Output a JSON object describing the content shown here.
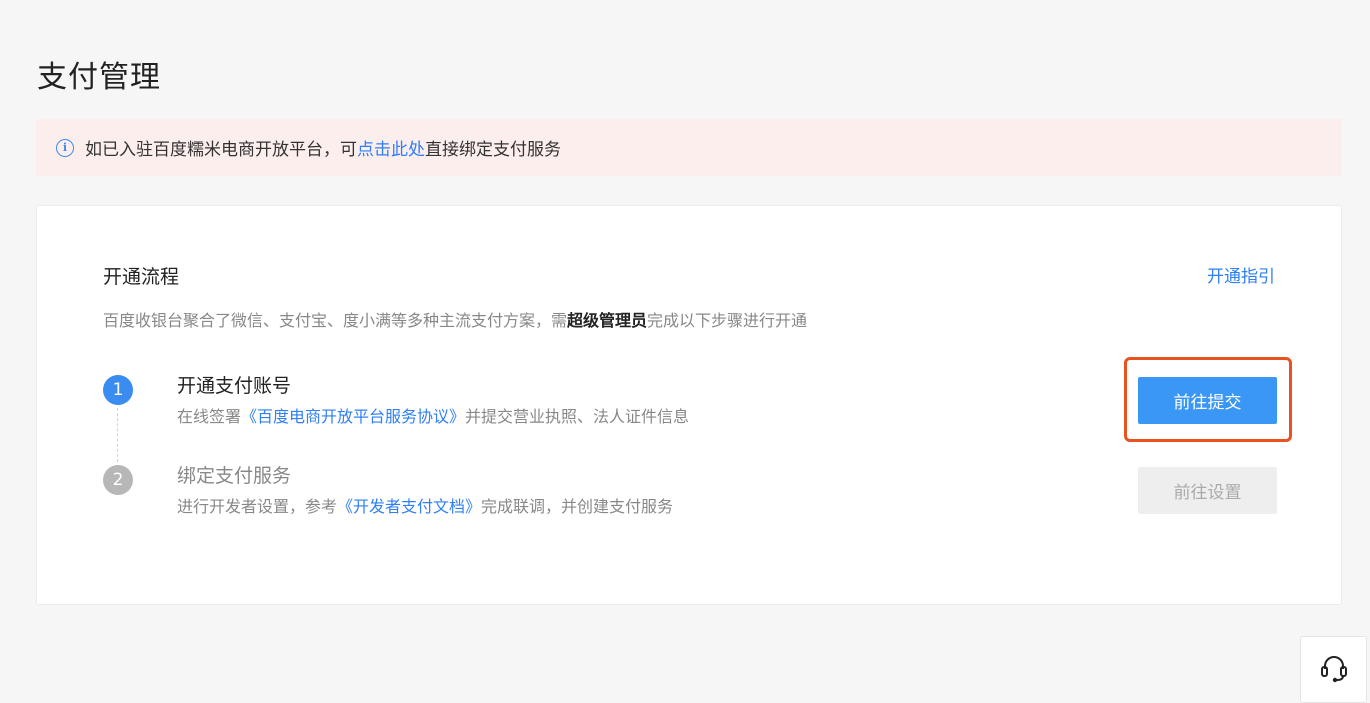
{
  "page": {
    "title": "支付管理"
  },
  "notice": {
    "icon": "info-icon",
    "prefix": "如已入驻百度糯米电商开放平台，可",
    "link": "点击此处",
    "suffix": "直接绑定支付服务"
  },
  "card": {
    "title": "开通流程",
    "guide_link": "开通指引",
    "desc_prefix": "百度收银台聚合了微信、支付宝、度小满等多种主流支付方案，需",
    "desc_bold": "超级管理员",
    "desc_suffix": "完成以下步骤进行开通"
  },
  "steps": [
    {
      "number": "1",
      "title": "开通支付账号",
      "desc_prefix": "在线签署",
      "desc_link": "《百度电商开放平台服务协议》",
      "desc_suffix": "并提交营业执照、法人证件信息",
      "button": "前往提交"
    },
    {
      "number": "2",
      "title": "绑定支付服务",
      "desc_prefix": "进行开发者设置，参考",
      "desc_link": "《开发者支付文档》",
      "desc_suffix": "完成联调，并创建支付服务",
      "button": "前往设置"
    }
  ],
  "support": {
    "icon": "headset-icon"
  },
  "colors": {
    "accent": "#3b97f6",
    "link": "#2f7ff5",
    "highlight": "#e8521f",
    "notice_bg": "#fdeeee"
  }
}
